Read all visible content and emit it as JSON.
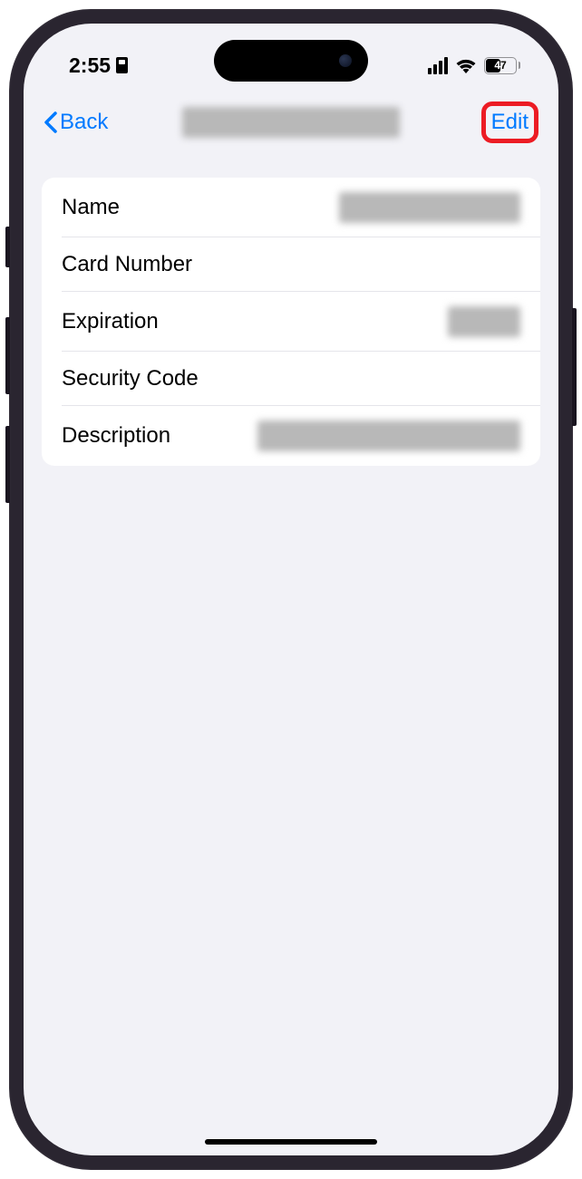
{
  "status": {
    "time": "2:55",
    "battery_level": "47"
  },
  "nav": {
    "back_label": "Back",
    "edit_label": "Edit"
  },
  "fields": {
    "name_label": "Name",
    "card_number_label": "Card Number",
    "expiration_label": "Expiration",
    "security_code_label": "Security Code",
    "description_label": "Description"
  }
}
